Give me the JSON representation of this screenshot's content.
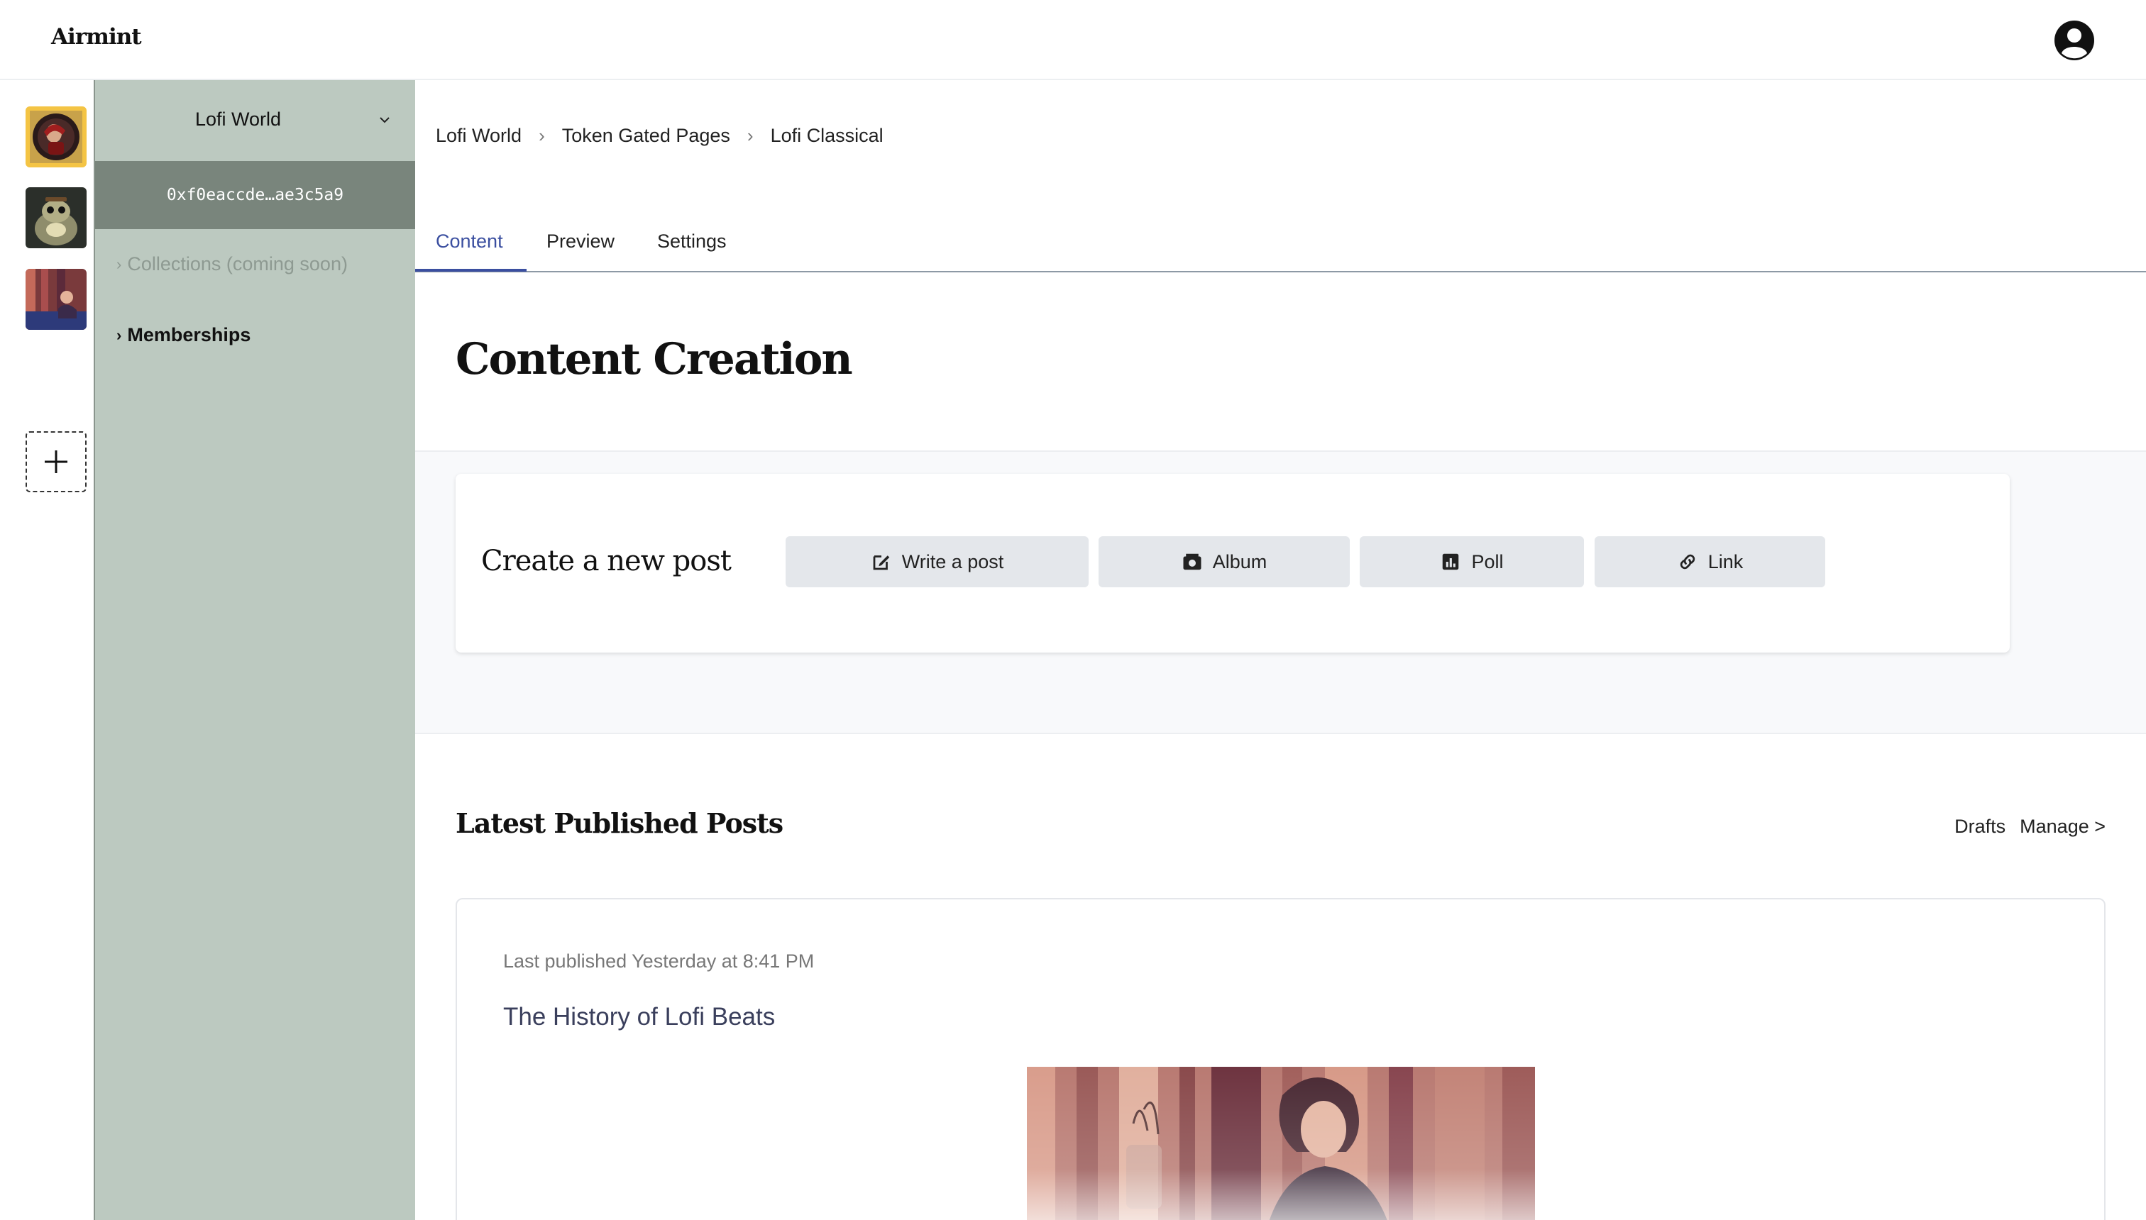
{
  "app": {
    "logo": "Airmint"
  },
  "sidebar": {
    "org_name": "Lofi World",
    "wallet": "0xf0eaccde…ae3c5a9",
    "items": [
      {
        "label": "Collections (coming soon)"
      },
      {
        "label": "Memberships"
      }
    ]
  },
  "breadcrumb": [
    "Lofi World",
    "Token Gated Pages",
    "Lofi Classical"
  ],
  "tabs": [
    {
      "label": "Content"
    },
    {
      "label": "Preview"
    },
    {
      "label": "Settings"
    }
  ],
  "page": {
    "title": "Content Creation"
  },
  "create": {
    "title": "Create a new post",
    "buttons": [
      {
        "label": "Write a post",
        "icon": "edit-icon"
      },
      {
        "label": "Album",
        "icon": "camera-icon"
      },
      {
        "label": "Poll",
        "icon": "bar-chart-icon"
      },
      {
        "label": "Link",
        "icon": "link-icon"
      }
    ]
  },
  "posts": {
    "title": "Latest Published Posts",
    "drafts_label": "Drafts",
    "manage_label": "Manage >",
    "latest": {
      "meta": "Last published Yesterday at 8:41 PM",
      "title": "The History of Lofi Beats"
    }
  },
  "colors": {
    "sidebar_bg": "#bcc9c0",
    "wallet_bg": "#79857c",
    "active_tab": "#3b4fa0",
    "active_org_border": "#f4c444",
    "button_bg": "#e4e7eb"
  }
}
